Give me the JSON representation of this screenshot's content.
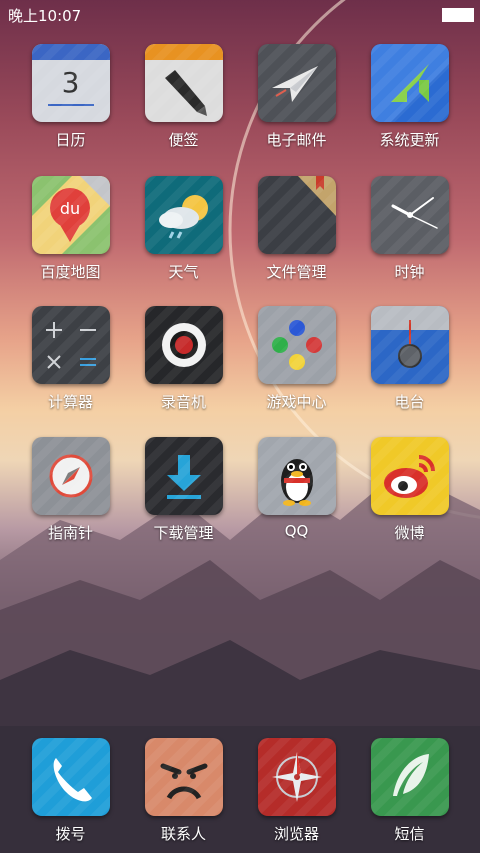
{
  "status_bar": {
    "time": "晚上10:07"
  },
  "apps": [
    {
      "name": "calendar",
      "label": "日历",
      "day": "3",
      "color": "#cfd3da"
    },
    {
      "name": "notes",
      "label": "便签",
      "color": "#e7e2d6"
    },
    {
      "name": "email",
      "label": "电子邮件",
      "color": "#5a5d63"
    },
    {
      "name": "system-update",
      "label": "系统更新",
      "color": "#2d6ccb"
    },
    {
      "name": "baidu-maps",
      "label": "百度地图",
      "logo": "du",
      "color": "#7fbf6b"
    },
    {
      "name": "weather",
      "label": "天气",
      "color": "#0e6e7e"
    },
    {
      "name": "file-manager",
      "label": "文件管理",
      "color": "#3d4046"
    },
    {
      "name": "clock",
      "label": "时钟",
      "color": "#5c5f66"
    },
    {
      "name": "calculator",
      "label": "计算器",
      "color": "#3f4246"
    },
    {
      "name": "recorder",
      "label": "录音机",
      "color": "#2a2b2e"
    },
    {
      "name": "game-center",
      "label": "游戏中心",
      "color": "#9aa0a8"
    },
    {
      "name": "radio",
      "label": "电台",
      "color": "#2d68c8"
    },
    {
      "name": "compass",
      "label": "指南针",
      "color": "#8e9298"
    },
    {
      "name": "download-manager",
      "label": "下载管理",
      "color": "#2b2c30"
    },
    {
      "name": "qq",
      "label": "QQ",
      "color": "#9fa4ab"
    },
    {
      "name": "weibo",
      "label": "微博",
      "color": "#f0c928"
    }
  ],
  "dock": [
    {
      "name": "phone",
      "label": "拨号",
      "color": "#1f9ed8"
    },
    {
      "name": "contacts",
      "label": "联系人",
      "color": "#d98a68"
    },
    {
      "name": "browser",
      "label": "浏览器",
      "color": "#b72d2a"
    },
    {
      "name": "messages",
      "label": "短信",
      "color": "#3a9a54"
    }
  ]
}
